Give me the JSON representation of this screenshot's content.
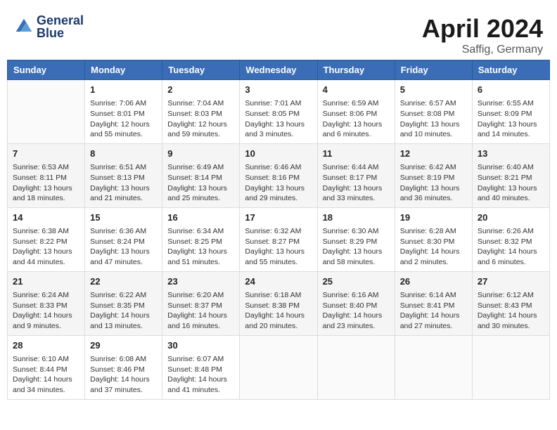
{
  "header": {
    "logo_line1": "General",
    "logo_line2": "Blue",
    "month": "April 2024",
    "location": "Saffig, Germany"
  },
  "weekdays": [
    "Sunday",
    "Monday",
    "Tuesday",
    "Wednesday",
    "Thursday",
    "Friday",
    "Saturday"
  ],
  "weeks": [
    [
      {
        "day": "",
        "info": ""
      },
      {
        "day": "1",
        "info": "Sunrise: 7:06 AM\nSunset: 8:01 PM\nDaylight: 12 hours\nand 55 minutes."
      },
      {
        "day": "2",
        "info": "Sunrise: 7:04 AM\nSunset: 8:03 PM\nDaylight: 12 hours\nand 59 minutes."
      },
      {
        "day": "3",
        "info": "Sunrise: 7:01 AM\nSunset: 8:05 PM\nDaylight: 13 hours\nand 3 minutes."
      },
      {
        "day": "4",
        "info": "Sunrise: 6:59 AM\nSunset: 8:06 PM\nDaylight: 13 hours\nand 6 minutes."
      },
      {
        "day": "5",
        "info": "Sunrise: 6:57 AM\nSunset: 8:08 PM\nDaylight: 13 hours\nand 10 minutes."
      },
      {
        "day": "6",
        "info": "Sunrise: 6:55 AM\nSunset: 8:09 PM\nDaylight: 13 hours\nand 14 minutes."
      }
    ],
    [
      {
        "day": "7",
        "info": "Sunrise: 6:53 AM\nSunset: 8:11 PM\nDaylight: 13 hours\nand 18 minutes."
      },
      {
        "day": "8",
        "info": "Sunrise: 6:51 AM\nSunset: 8:13 PM\nDaylight: 13 hours\nand 21 minutes."
      },
      {
        "day": "9",
        "info": "Sunrise: 6:49 AM\nSunset: 8:14 PM\nDaylight: 13 hours\nand 25 minutes."
      },
      {
        "day": "10",
        "info": "Sunrise: 6:46 AM\nSunset: 8:16 PM\nDaylight: 13 hours\nand 29 minutes."
      },
      {
        "day": "11",
        "info": "Sunrise: 6:44 AM\nSunset: 8:17 PM\nDaylight: 13 hours\nand 33 minutes."
      },
      {
        "day": "12",
        "info": "Sunrise: 6:42 AM\nSunset: 8:19 PM\nDaylight: 13 hours\nand 36 minutes."
      },
      {
        "day": "13",
        "info": "Sunrise: 6:40 AM\nSunset: 8:21 PM\nDaylight: 13 hours\nand 40 minutes."
      }
    ],
    [
      {
        "day": "14",
        "info": "Sunrise: 6:38 AM\nSunset: 8:22 PM\nDaylight: 13 hours\nand 44 minutes."
      },
      {
        "day": "15",
        "info": "Sunrise: 6:36 AM\nSunset: 8:24 PM\nDaylight: 13 hours\nand 47 minutes."
      },
      {
        "day": "16",
        "info": "Sunrise: 6:34 AM\nSunset: 8:25 PM\nDaylight: 13 hours\nand 51 minutes."
      },
      {
        "day": "17",
        "info": "Sunrise: 6:32 AM\nSunset: 8:27 PM\nDaylight: 13 hours\nand 55 minutes."
      },
      {
        "day": "18",
        "info": "Sunrise: 6:30 AM\nSunset: 8:29 PM\nDaylight: 13 hours\nand 58 minutes."
      },
      {
        "day": "19",
        "info": "Sunrise: 6:28 AM\nSunset: 8:30 PM\nDaylight: 14 hours\nand 2 minutes."
      },
      {
        "day": "20",
        "info": "Sunrise: 6:26 AM\nSunset: 8:32 PM\nDaylight: 14 hours\nand 6 minutes."
      }
    ],
    [
      {
        "day": "21",
        "info": "Sunrise: 6:24 AM\nSunset: 8:33 PM\nDaylight: 14 hours\nand 9 minutes."
      },
      {
        "day": "22",
        "info": "Sunrise: 6:22 AM\nSunset: 8:35 PM\nDaylight: 14 hours\nand 13 minutes."
      },
      {
        "day": "23",
        "info": "Sunrise: 6:20 AM\nSunset: 8:37 PM\nDaylight: 14 hours\nand 16 minutes."
      },
      {
        "day": "24",
        "info": "Sunrise: 6:18 AM\nSunset: 8:38 PM\nDaylight: 14 hours\nand 20 minutes."
      },
      {
        "day": "25",
        "info": "Sunrise: 6:16 AM\nSunset: 8:40 PM\nDaylight: 14 hours\nand 23 minutes."
      },
      {
        "day": "26",
        "info": "Sunrise: 6:14 AM\nSunset: 8:41 PM\nDaylight: 14 hours\nand 27 minutes."
      },
      {
        "day": "27",
        "info": "Sunrise: 6:12 AM\nSunset: 8:43 PM\nDaylight: 14 hours\nand 30 minutes."
      }
    ],
    [
      {
        "day": "28",
        "info": "Sunrise: 6:10 AM\nSunset: 8:44 PM\nDaylight: 14 hours\nand 34 minutes."
      },
      {
        "day": "29",
        "info": "Sunrise: 6:08 AM\nSunset: 8:46 PM\nDaylight: 14 hours\nand 37 minutes."
      },
      {
        "day": "30",
        "info": "Sunrise: 6:07 AM\nSunset: 8:48 PM\nDaylight: 14 hours\nand 41 minutes."
      },
      {
        "day": "",
        "info": ""
      },
      {
        "day": "",
        "info": ""
      },
      {
        "day": "",
        "info": ""
      },
      {
        "day": "",
        "info": ""
      }
    ]
  ]
}
